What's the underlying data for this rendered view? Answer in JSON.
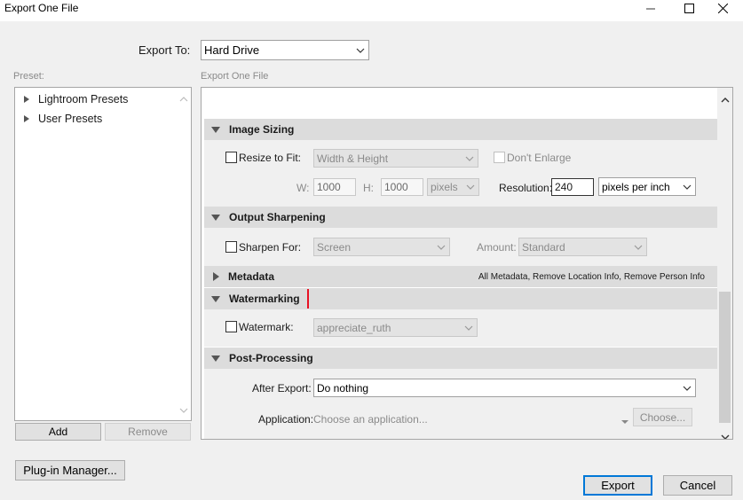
{
  "window": {
    "title": "Export One File",
    "minimize_icon": "minimize-icon",
    "maximize_icon": "maximize-icon",
    "close_icon": "close-icon"
  },
  "export_to": {
    "label": "Export To:",
    "value": "Hard Drive"
  },
  "preset": {
    "label": "Preset:",
    "items": [
      "Lightroom Presets",
      "User Presets"
    ],
    "add_label": "Add",
    "remove_label": "Remove"
  },
  "panel": {
    "label": "Export One File"
  },
  "image_sizing": {
    "title": "Image Sizing",
    "resize_label": "Resize to Fit:",
    "resize_value": "Width & Height",
    "dont_enlarge_label": "Don't Enlarge",
    "w_label": "W:",
    "w_value": "1000",
    "h_label": "H:",
    "h_value": "1000",
    "unit_value": "pixels",
    "resolution_label": "Resolution:",
    "resolution_value": "240",
    "resolution_unit": "pixels per inch"
  },
  "output_sharpening": {
    "title": "Output Sharpening",
    "sharpen_label": "Sharpen For:",
    "sharpen_value": "Screen",
    "amount_label": "Amount:",
    "amount_value": "Standard"
  },
  "metadata": {
    "title": "Metadata",
    "summary": "All Metadata, Remove Location Info, Remove Person Info"
  },
  "watermarking": {
    "title": "Watermarking",
    "watermark_label": "Watermark:",
    "watermark_value": "appreciate_ruth"
  },
  "post_processing": {
    "title": "Post-Processing",
    "after_export_label": "After Export:",
    "after_export_value": "Do nothing",
    "application_label": "Application:",
    "application_placeholder": "Choose an application...",
    "choose_label": "Choose..."
  },
  "footer": {
    "plugin_manager_label": "Plug-in Manager...",
    "export_label": "Export",
    "cancel_label": "Cancel"
  },
  "colors": {
    "accent": "#0078d7",
    "red_marker": "#e81123"
  }
}
